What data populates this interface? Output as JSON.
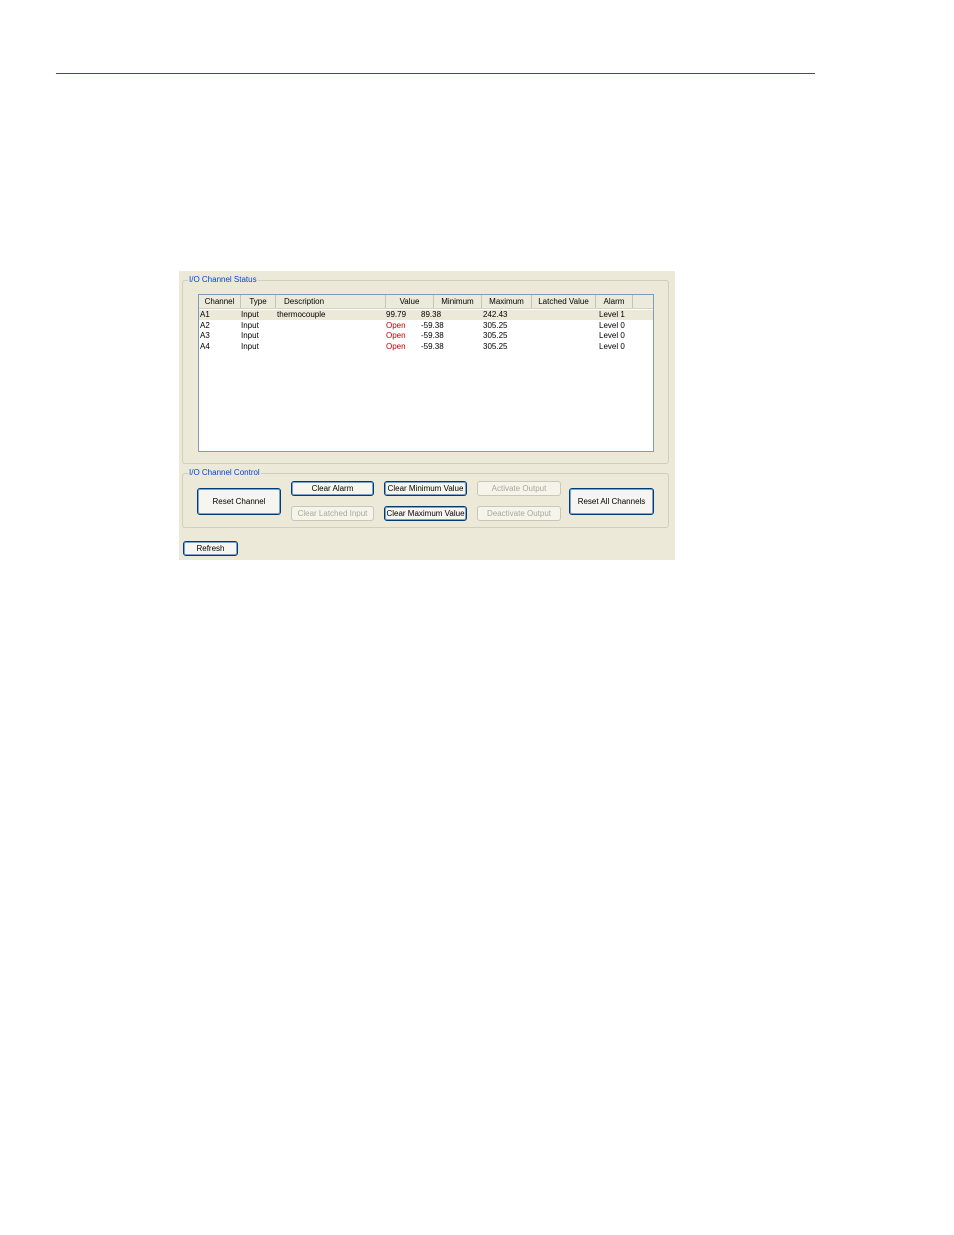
{
  "status_group": {
    "title": "I/O Channel Status",
    "columns": [
      "Channel",
      "Type",
      "Description",
      "Value",
      "Minimum",
      "Maximum",
      "Latched Value",
      "Alarm"
    ],
    "rows": [
      {
        "channel": "A1",
        "type": "Input",
        "description": "thermocouple",
        "value": "99.79",
        "value_state": "normal",
        "minimum": "89.38",
        "maximum": "242.43",
        "latched": "",
        "alarm": "Level 1"
      },
      {
        "channel": "A2",
        "type": "Input",
        "description": "",
        "value": "Open",
        "value_state": "open",
        "minimum": "-59.38",
        "maximum": "305.25",
        "latched": "",
        "alarm": "Level 0"
      },
      {
        "channel": "A3",
        "type": "Input",
        "description": "",
        "value": "Open",
        "value_state": "open",
        "minimum": "-59.38",
        "maximum": "305.25",
        "latched": "",
        "alarm": "Level 0"
      },
      {
        "channel": "A4",
        "type": "Input",
        "description": "",
        "value": "Open",
        "value_state": "open",
        "minimum": "-59.38",
        "maximum": "305.25",
        "latched": "",
        "alarm": "Level 0"
      }
    ],
    "selected_row": 0,
    "open_color": "#c00000"
  },
  "control_group": {
    "title": "I/O Channel Control",
    "buttons": {
      "reset_channel": "Reset Channel",
      "clear_alarm": "Clear Alarm",
      "clear_latched_input": "Clear Latched Input",
      "clear_minimum_value": "Clear Minimum Value",
      "clear_maximum_value": "Clear Maximum Value",
      "activate_output": "Activate Output",
      "deactivate_output": "Deactivate Output",
      "reset_all_channels": "Reset All Channels"
    }
  },
  "refresh_label": "Refresh",
  "colors": {
    "group_title": "#0046d5",
    "panel_bg": "#ece9d8",
    "rule": "#3a4a8c"
  }
}
